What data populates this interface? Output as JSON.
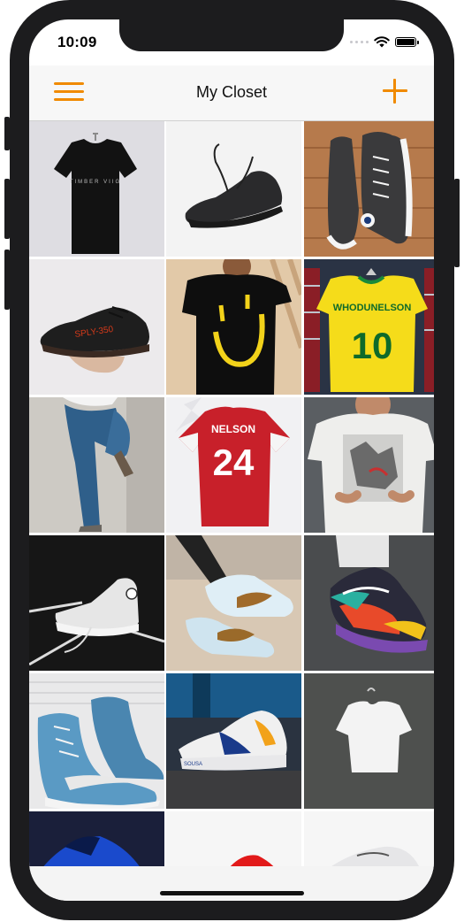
{
  "status_bar": {
    "time": "10:09"
  },
  "nav": {
    "title": "My Closet",
    "menu_icon": "hamburger-menu-icon",
    "add_icon": "plus-icon",
    "accent_color": "#f08a00"
  },
  "closet": {
    "items": [
      {
        "name": "black-tshirt-item",
        "print": "TIMBER VIIG"
      },
      {
        "name": "black-running-sneaker-item",
        "print": ""
      },
      {
        "name": "black-converse-hightop-item",
        "print": ""
      },
      {
        "name": "black-yeezy-sneaker-item",
        "print": "SPLY-350"
      },
      {
        "name": "smiley-print-tshirt-item",
        "print": ""
      },
      {
        "name": "yellow-brazil-jersey-item",
        "print": "WHODUNELSON",
        "number": "10"
      },
      {
        "name": "blue-jeans-item",
        "print": ""
      },
      {
        "name": "red-arsenal-jersey-item",
        "print": "NELSON",
        "number": "24"
      },
      {
        "name": "white-graphic-tshirt-item",
        "print": ""
      },
      {
        "name": "white-converse-hightop-item",
        "print": ""
      },
      {
        "name": "white-nike-af1-sneaker-item",
        "print": ""
      },
      {
        "name": "multicolor-airmax-sneaker-item",
        "print": ""
      },
      {
        "name": "blue-nike-blazer-item",
        "print": ""
      },
      {
        "name": "white-blue-runner-sneaker-item",
        "print": ""
      },
      {
        "name": "plain-white-tshirt-item",
        "print": ""
      },
      {
        "name": "blue-sneaker-partial-item",
        "print": ""
      },
      {
        "name": "red-sneaker-partial-item",
        "print": ""
      },
      {
        "name": "white-sneaker-partial-item",
        "print": ""
      }
    ]
  }
}
